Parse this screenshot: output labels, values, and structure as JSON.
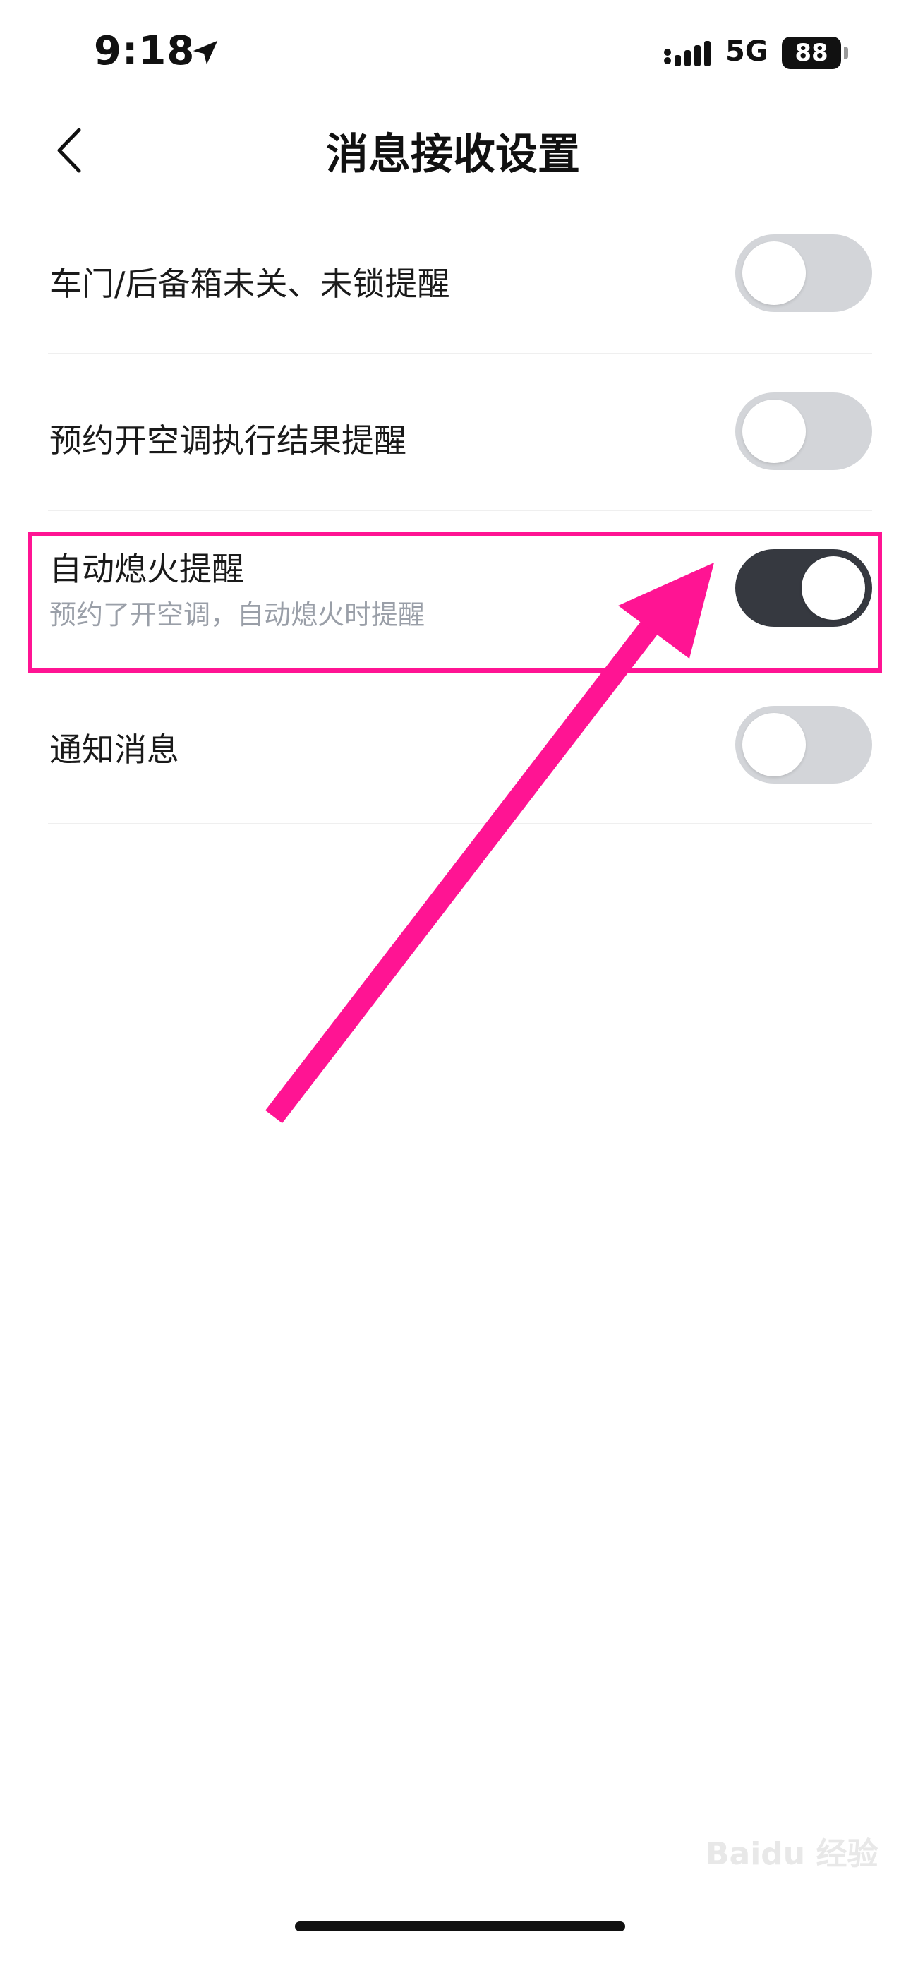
{
  "status_bar": {
    "time": "9:18",
    "network": "5G",
    "battery": "88",
    "icons": [
      "location-arrow-icon",
      "signal-icon",
      "battery-icon"
    ]
  },
  "nav": {
    "back_icon": "chevron-left-icon",
    "title": "消息接收设置"
  },
  "settings": [
    {
      "label": "车门/后备箱未关、未锁提醒",
      "subtitle": "",
      "enabled": false
    },
    {
      "label": "预约开空调执行结果提醒",
      "subtitle": "",
      "enabled": false
    },
    {
      "label": "自动熄火提醒",
      "subtitle": "预约了开空调，自动熄火时提醒",
      "enabled": true
    },
    {
      "label": "通知消息",
      "subtitle": "",
      "enabled": false
    }
  ],
  "annotation": {
    "highlight_color": "#ff1493",
    "arrow_color": "#ff1493"
  },
  "colors": {
    "toggle_on": "#363940",
    "toggle_off": "#d3d5d9"
  }
}
